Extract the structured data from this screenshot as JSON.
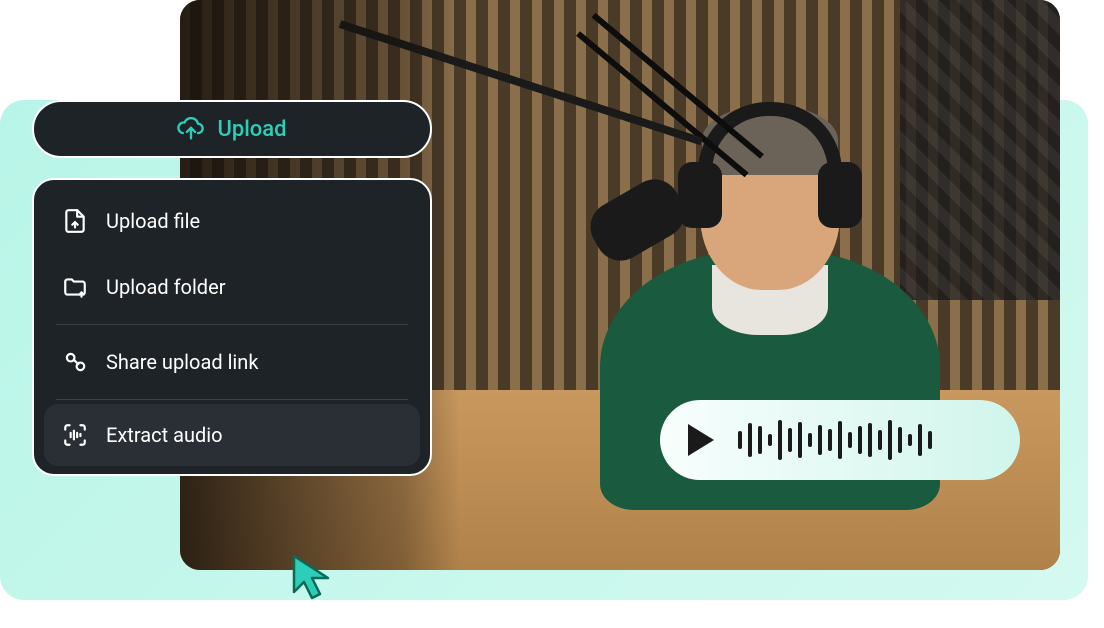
{
  "upload": {
    "button_label": "Upload"
  },
  "menu": {
    "items": [
      {
        "label": "Upload file",
        "icon": "file-upload-icon"
      },
      {
        "label": "Upload folder",
        "icon": "folder-upload-icon"
      },
      {
        "label": "Share upload link",
        "icon": "share-link-icon"
      },
      {
        "label": "Extract audio",
        "icon": "extract-audio-icon"
      }
    ]
  },
  "colors": {
    "accent": "#2dceb8",
    "panel_bg": "#1e2328",
    "mint": "#b8f5e8"
  },
  "waveform": {
    "bars": [
      18,
      34,
      28,
      12,
      40,
      24,
      36,
      14,
      30,
      22,
      38,
      16,
      28,
      34,
      20,
      40,
      26,
      12,
      32,
      18
    ]
  }
}
